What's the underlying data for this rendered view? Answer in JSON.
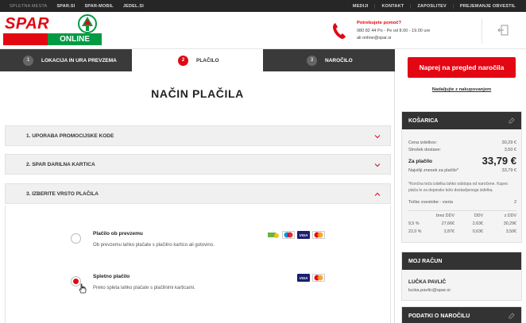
{
  "topbar": {
    "left": [
      "SPLETNA MESTA",
      "SPAR.SI",
      "SPAR-MOBIL",
      "JEDEL.SI"
    ],
    "right": [
      "MEDIJI",
      "KONTAKT",
      "ZAPOSLITEV",
      "PREJEMANJE OBVESTIL"
    ]
  },
  "logo": {
    "spar": "SPAR",
    "online": "ONLINE"
  },
  "help": {
    "title": "Potrebujete pomoč?",
    "hours": "080 82 44  Po - Pe od 8.00 - 19.00 ure",
    "email": "ali online@spar.si"
  },
  "steps": [
    {
      "num": "1",
      "label": "LOKACIJA IN URA PREVZEMA"
    },
    {
      "num": "2",
      "label": "PLAČILO"
    },
    {
      "num": "3",
      "label": "NAROČILO"
    }
  ],
  "main": {
    "title": "NAČIN PLAČILA",
    "sections": [
      "1. UPORABA PROMOCIJSKE KODE",
      "2. SPAR DARILNA KARTICA",
      "3. IZBERITE VRSTO PLAČILA"
    ],
    "options": [
      {
        "name": "Plačilo ob prevzemu",
        "desc": "Ob prevzemu lahko plačate s plačilno kartico ali gotovino.",
        "selected": false
      },
      {
        "name": "Spletno plačilo",
        "desc": "Preko spleta lahko plačate s plačilnimi karticami.",
        "selected": true
      }
    ],
    "card_visa": "VISA"
  },
  "side": {
    "cta": "Naprej na pregled naročila",
    "continue": "Nadaljujte z nakupovanjem",
    "cart": {
      "title": "KOŠARICA",
      "rows": [
        {
          "label": "Cena izdelkov:",
          "value": "30,29 €"
        },
        {
          "label": "Strošek dostave:",
          "value": "3,50 €"
        }
      ],
      "total_label": "Za plačilo",
      "total_value": "33,79 €",
      "min_label": "Najvišji znesek za plačilo*",
      "min_value": "33,79 €",
      "note": "*Končna teža izdelka lahko odstopa od naročene. Kupec plača le za dejansko težo dostavljenega izdelka.",
      "points_label": "Točke zvestobe - vsota",
      "points_value": "2",
      "vat_headers": [
        "brez DDV",
        "DDV",
        "z DDV"
      ],
      "vat_rows": [
        [
          "9,5 %",
          "27,66€",
          "2,63€",
          "30,29€"
        ],
        [
          "22,0 %",
          "2,87€",
          "0,63€",
          "3,50€"
        ]
      ]
    },
    "account": {
      "title": "MOJ RAČUN",
      "name": "LUČKA PAVLIČ",
      "email": "lucka.pavlic@spar.si"
    },
    "order": {
      "title": "PODATKI O NAROČILU"
    }
  },
  "colors": {
    "accent": "#e30613",
    "brand_green": "#009a44",
    "dark": "#333333"
  }
}
